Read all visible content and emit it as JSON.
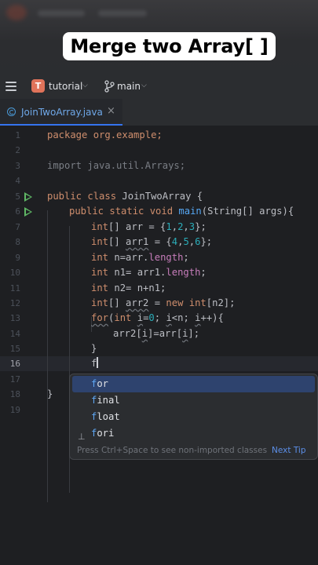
{
  "overlay": {
    "title": "Merge two Array[ ]"
  },
  "toolbar": {
    "project_initial": "T",
    "project_name": "tutorial",
    "branch_name": "main"
  },
  "tab": {
    "file_name": "JoinTwoArray.java",
    "close_symbol": "×"
  },
  "editor": {
    "line_numbers": [
      "1",
      "2",
      "3",
      "4",
      "5",
      "6",
      "7",
      "8",
      "9",
      "10",
      "11",
      "12",
      "13",
      "14",
      "15",
      "16",
      "17",
      "18",
      "19"
    ],
    "current_line": "16",
    "code": {
      "l1": "package org.example;",
      "l3": "import java.util.Arrays;",
      "l5a": "public class ",
      "l5b": "JoinTwoArray {",
      "l6a": "public static void ",
      "l6b": "main",
      "l6c": "(String[] args){",
      "l7a": "int",
      "l7b": "[] arr = {",
      "l7c": "1",
      "l7d": ",",
      "l7e": "2",
      "l7f": ",",
      "l7g": "3",
      "l7h": "};",
      "l8a": "int",
      "l8b": "[] ",
      "l8c": "arr1",
      "l8d": " = {",
      "l8e": "4",
      "l8f": ",",
      "l8g": "5",
      "l8h": ",",
      "l8i": "6",
      "l8j": "};",
      "l9a": "int",
      "l9b": " n=arr.",
      "l9c": "length",
      "l9d": ";",
      "l10a": "int",
      "l10b": " n1= arr1.",
      "l10c": "length",
      "l10d": ";",
      "l11a": "int",
      "l11b": " n2= n+n1;",
      "l12a": "int",
      "l12b": "[] ",
      "l12c": "arr2",
      "l12d": " = ",
      "l12e": "new int",
      "l12f": "[n2];",
      "l13a": "for",
      "l13b": "(",
      "l13c": "int",
      "l13d": " ",
      "l13e": "i",
      "l13f": "=",
      "l13g": "0",
      "l13h": "; ",
      "l13i": "i",
      "l13j": "<n; ",
      "l13k": "i",
      "l13l": "++){",
      "l14a": "arr2[",
      "l14b": "i",
      "l14c": "]=arr[",
      "l14d": "i",
      "l14e": "];",
      "l15": "}",
      "l16": "f",
      "l18": "}"
    }
  },
  "completion": {
    "items": [
      {
        "prefix": "f",
        "rest": "or",
        "icon": ""
      },
      {
        "prefix": "f",
        "rest": "inal",
        "icon": ""
      },
      {
        "prefix": "f",
        "rest": "loat",
        "icon": ""
      },
      {
        "prefix": "f",
        "rest": "ori",
        "icon": "template-icon"
      }
    ],
    "footer_hint": "Press Ctrl+Space to see non-imported classes",
    "footer_link": "Next Tip"
  },
  "colors": {
    "keyword": "#cf8e6d",
    "method": "#56a8f5",
    "number": "#2aacb8",
    "field": "#c77dbb",
    "selection": "#2e436e",
    "run_icon": "#5fb865",
    "tab_accent": "#3574f0"
  }
}
